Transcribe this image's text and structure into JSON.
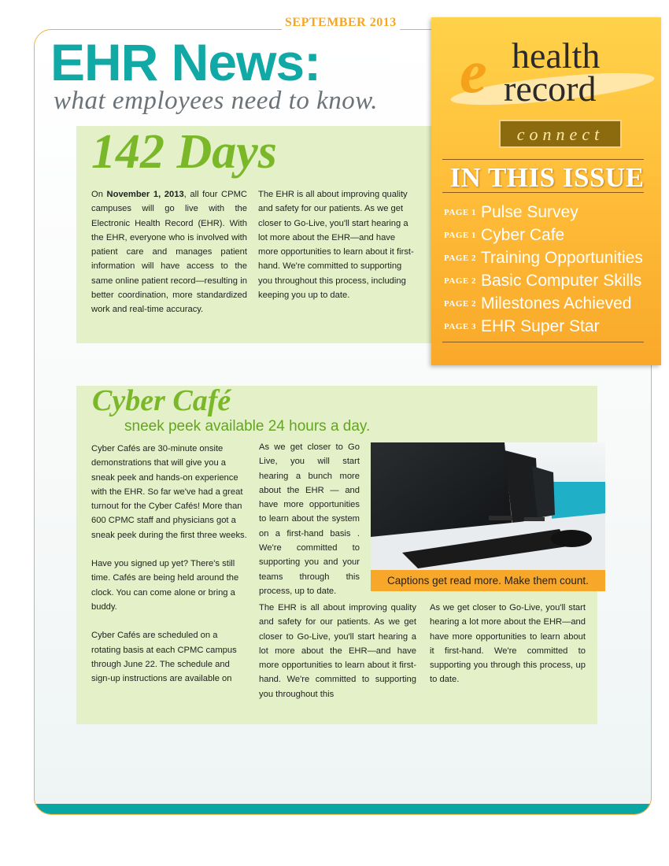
{
  "header": {
    "date": "SEPTEMBER 2013",
    "title": "EHR News:",
    "subtitle": "what employees need to know."
  },
  "logo": {
    "e": "e",
    "health": "health",
    "record": "record",
    "connect": "connect"
  },
  "sidebar": {
    "title": "IN THIS ISSUE",
    "items": [
      {
        "page": "PAGE 1",
        "label": "Pulse Survey"
      },
      {
        "page": "PAGE 1",
        "label": "Cyber Cafe"
      },
      {
        "page": "PAGE 2",
        "label": "Training Opportunities"
      },
      {
        "page": "PAGE 2",
        "label": "Basic Computer Skills"
      },
      {
        "page": "PAGE 2",
        "label": "Milestones Achieved"
      },
      {
        "page": "PAGE 3",
        "label": "EHR Super Star"
      }
    ]
  },
  "days": {
    "heading": "142 Days",
    "col1_lead": "On ",
    "col1_bold": "November 1, 2013",
    "col1_rest": ", all four CPMC campuses will go live with the Electronic Health Record (EHR). With the EHR, everyone who is involved with patient care and manages patient information will have access to the same online patient record—resulting in better coordination, more standardized work and real-time accuracy.",
    "col2": "The EHR is all about improving quality and safety for our patients. As we get closer to Go-Live, you'll start hearing a lot more about the EHR—and have more opportunities to learn about it first-hand. We're committed to supporting you throughout this process, including keeping you up to date."
  },
  "cafe": {
    "heading": "Cyber Café",
    "subheading": "sneek peek available 24 hours a day.",
    "col1_p1": "Cyber Cafés are 30-minute onsite demonstrations that will give you a sneak peek and hands-on experience with the EHR. So far we've had a great turnout for the Cyber Cafés! More than 600 CPMC staff and physicians got a sneak peek during the first three weeks.",
    "col1_p2": "Have you signed up yet? There's still time. Cafés are being held around the clock. You can come alone or bring a buddy.",
    "col1_p3": "Cyber Cafés are scheduled on a rotating basis at each CPMC campus through June 22. The schedule and sign-up instructions are available on",
    "col2_top": "As we get closer to Go Live, you will start hearing a bunch more about the EHR — and have more opportunities to learn about the system on a first-hand basis . We're committed to supporting you and your teams through this process, up to date.",
    "col2_bottom": "The EHR is all about improving quality and safety for our patients. As we get closer to Go-Live, you'll start hearing a lot more about the EHR—and have more opportunities to learn about it first-hand. We're committed to supporting you throughout this",
    "col3": "As we get closer to Go-Live, you'll start hearing a lot more about the EHR—and have more opportunities to learn about it first-hand. We're committed to supporting you through this process, up to date.",
    "caption": "Captions get read more. Make them count."
  },
  "colors": {
    "teal": "#11a9a6",
    "green": "#7ab82a",
    "panel": "#e4f1c8",
    "orange": "#f7a82b"
  }
}
